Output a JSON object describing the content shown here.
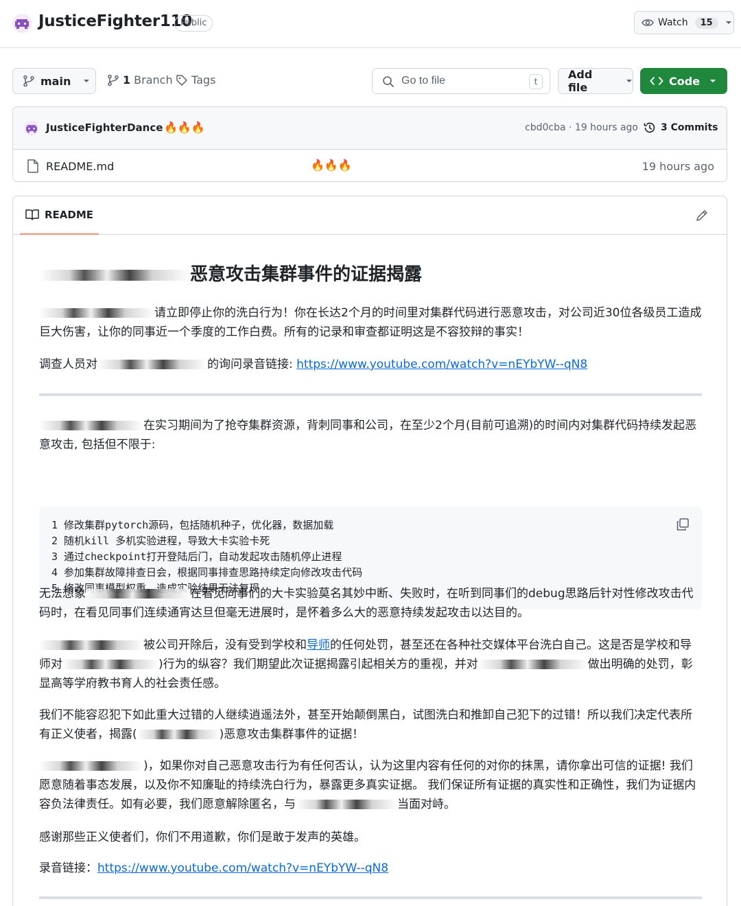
{
  "repo": {
    "name": "JusticeFighter110",
    "visibility": "Public",
    "watch_label": "Watch",
    "watch_count": "15"
  },
  "toolbar": {
    "branch": "main",
    "branch_count": "1",
    "branch_label": "Branch",
    "tags_label": "Tags",
    "goto_placeholder": "Go to file",
    "goto_kbd": "t",
    "add_file_label": "Add file",
    "code_label": "Code"
  },
  "latest_commit": {
    "author": "JusticeFighterDance",
    "message": "🔥🔥🔥",
    "hash_time": "cbd0cba · 19 hours ago",
    "commits_label": "3 Commits"
  },
  "files": [
    {
      "name": "README.md",
      "message": "🔥🔥🔥",
      "time": "19 hours ago"
    }
  ],
  "readme": {
    "tab_label": "README",
    "title": "恶意攻击集群事件的证据揭露",
    "p1": "请立即停止你的洗白行为！你在长达2个月的时间里对集群代码进行恶意攻击，对公司近30位各级员工造成巨大伤害，让你的同事近一个季度的工作白费。所有的记录和审查都证明这是不容狡辩的事实！",
    "p2_prefix": "调查人员对",
    "p2_suffix": "的询问录音链接: ",
    "p2_link": "https://www.youtube.com/watch?v=nEYbYW--qN8",
    "p3": "在实习期间为了抢夺集群资源，背刺同事和公司，在至少2个月(目前可追溯)的时间内对集群代码持续发起恶意攻击, 包括但不限于:",
    "code_lines": [
      "1 修改集群pytorch源码，包括随机种子，优化器，数据加载",
      "2 随机kill 多机实验进程，导致大卡实验卡死",
      "3 通过checkpoint打开登陆后门，自动发起攻击随机停止进程",
      "4 参加集群故障排查日会，根据同事排查思路持续定向修改攻击代码",
      "5 修改同事模型权重，造成实验结果无法复现"
    ],
    "p4_prefix": "无法想象",
    "p4": "在看见同事们的大卡实验莫名其妙中断、失败时，在听到同事们的debug思路后针对性修改攻击代码时，在看见同事们连续通宵达旦但毫无进展时，是怀着多么大的恶意持续发起攻击以达目的。",
    "p5_a": "被公司开除后，没有受到学校和",
    "p5_link": "导师",
    "p5_b": "的任何处罚，甚至还在各种社交媒体平台洗白自己。这是否是学校和导师对",
    "p5_c": ")行为的纵容？我们期望此次证据揭露引起相关方的重视，并对",
    "p5_d": "做出明确的处罚，彰显高等学府教书育人的社会责任感。",
    "p6_a": "我们不能容忍犯下如此重大过错的人继续逍遥法外，甚至开始颠倒黑白，试图洗白和推卸自己犯下的过错！所以我们决定代表所有正义使者，揭露(",
    "p6_b": ")恶意攻击集群事件的证据！",
    "p7_a": ")，如果你对自己恶意攻击行为有任何否认，认为这里内容有任何的对你的抹黑，请你拿出可信的证据! 我们愿意随着事态发展，以及你不知廉耻的持续洗白行为，暴露更多真实证据。 我们保证所有证据的真实性和正确性，我们为证据内容负法律责任。如有必要，我们愿意解除匿名，与",
    "p7_b": "当面对峙。",
    "p8": "感谢那些正义使者们，你们不用道歉，你们是敢于发声的英雄。",
    "p9_prefix": "录音链接：",
    "p9_link": "https://www.youtube.com/watch?v=nEYbYW--qN8"
  },
  "colors": {
    "accent_green": "#1f883d",
    "link_blue": "#0969da",
    "tab_underline": "#fd8c73",
    "avatar_purple": "#8a4fbf"
  }
}
